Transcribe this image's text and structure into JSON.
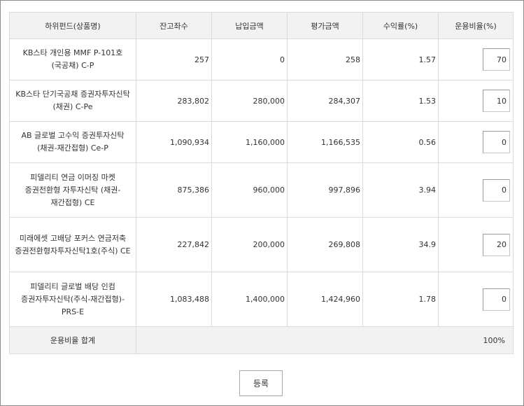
{
  "table": {
    "headers": [
      "하위펀드(상품명)",
      "잔고좌수",
      "납입금액",
      "평가금액",
      "수익률(%)",
      "운용비율(%)"
    ],
    "rows": [
      {
        "name": "KB스타 개인용 MMF P-101호(국공채) C-P",
        "units": "257",
        "paid": "0",
        "valuation": "258",
        "return_rate": "1.57",
        "ratio": "70"
      },
      {
        "name": "KB스타 단기국공채 증권자투자신탁(채권) C-Pe",
        "units": "283,802",
        "paid": "280,000",
        "valuation": "284,307",
        "return_rate": "1.53",
        "ratio": "10"
      },
      {
        "name": "AB 글로벌 고수익 증권투자신탁(채권-재간접형) Ce-P",
        "units": "1,090,934",
        "paid": "1,160,000",
        "valuation": "1,166,535",
        "return_rate": "0.56",
        "ratio": "0"
      },
      {
        "name": "피델리티 연금 이머징 마켓 증권전환형 자투자신탁 (채권-재간접형) CE",
        "units": "875,386",
        "paid": "960,000",
        "valuation": "997,896",
        "return_rate": "3.94",
        "ratio": "0"
      },
      {
        "name": "미래에셋 고배당 포커스 연금저축 증권전환형자투자신탁1호(주식) CE",
        "units": "227,842",
        "paid": "200,000",
        "valuation": "269,808",
        "return_rate": "34.9",
        "ratio": "20"
      },
      {
        "name": "피델리티 글로벌 배당 인컴 증권자투자신탁(주식-재간접형)-PRS-E",
        "units": "1,083,488",
        "paid": "1,400,000",
        "valuation": "1,424,960",
        "return_rate": "1.78",
        "ratio": "0"
      }
    ],
    "total_label": "운용비율 합계",
    "total_value": "100%"
  },
  "submit_label": "등록"
}
